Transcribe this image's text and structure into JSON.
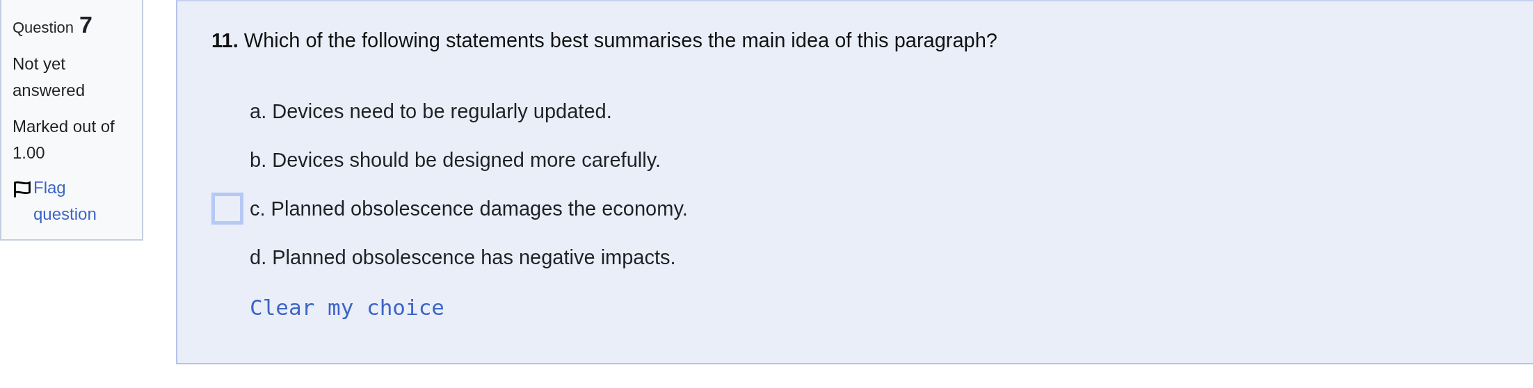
{
  "info": {
    "question_label": "Question",
    "question_number": "7",
    "status": "Not yet answered",
    "grade": "Marked out of 1.00",
    "flag_link": "Flag question"
  },
  "question": {
    "number": "11.",
    "text": "Which of the following statements best summarises the main idea of this paragraph?",
    "options": [
      {
        "label": "a. Devices need to be regularly updated.",
        "focused": false
      },
      {
        "label": "b. Devices should be designed more carefully.",
        "focused": false
      },
      {
        "label": "c. Planned obsolescence damages the economy.",
        "focused": true
      },
      {
        "label": "d. Planned obsolescence has negative impacts.",
        "focused": false
      }
    ],
    "clear_link": "Clear my choice"
  }
}
